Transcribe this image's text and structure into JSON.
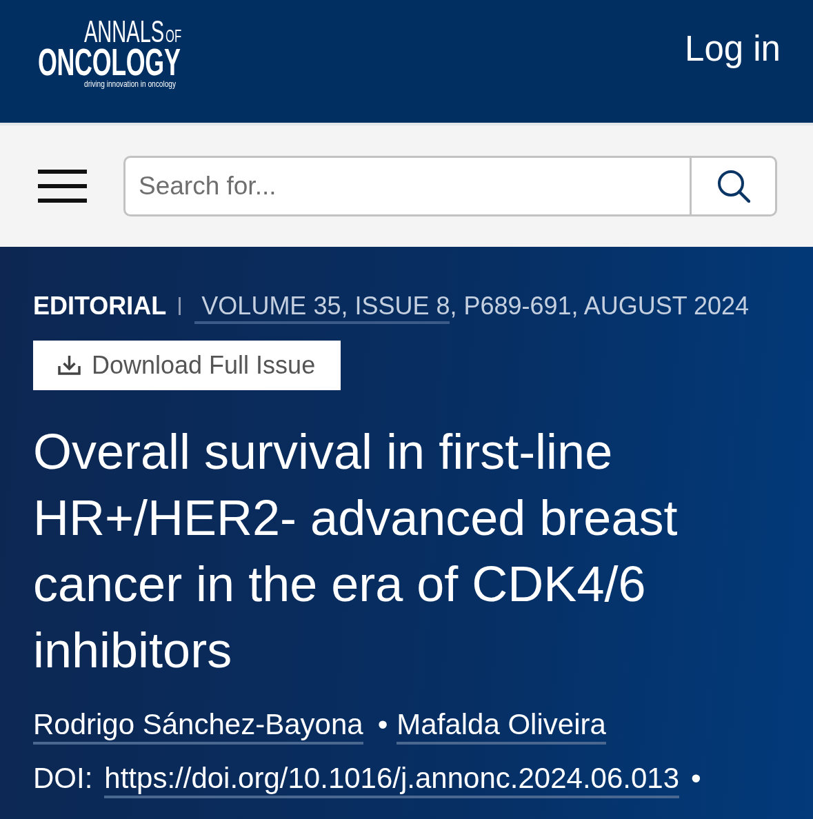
{
  "header": {
    "logo": {
      "line_1": "ANNALS",
      "line_1_suffix": "OF",
      "line_2": "ONCOLOGY",
      "tagline": "driving innovation in oncology"
    },
    "login": "Log in"
  },
  "search": {
    "placeholder": "Search for..."
  },
  "article": {
    "category": "EDITORIAL",
    "issue_link": "VOLUME 35, ISSUE 8",
    "issue_details": ", P689-691, AUGUST 2024",
    "download_button": "Download Full Issue",
    "title": "Overall survival in first-line HR+/HER2- advanced breast cancer in the era of CDK4/6 inhibitors",
    "authors": [
      "Rodrigo Sánchez-Bayona",
      "Mafalda Oliveira"
    ],
    "author_separator": "•",
    "doi": {
      "label": "DOI:",
      "link": "https://doi.org/10.1016/j.annonc.2024.06.013",
      "trailing": "•"
    }
  }
}
